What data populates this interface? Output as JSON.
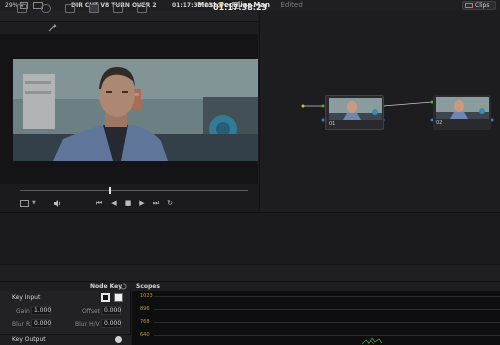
{
  "window": {
    "project_title": "Most Peculiar Man",
    "status": "Edited",
    "clips_label": "Clips"
  },
  "viewer": {
    "zoom": "29%",
    "clip_name": "DIR CUT V8 TURN OVER 2",
    "header_timecode": "01:17:38:23",
    "transport_timecode": "01:17:38:23",
    "playhead_fraction": 0.39
  },
  "nodes": [
    {
      "label": "01"
    },
    {
      "label": "02"
    }
  ],
  "node_key": {
    "title": "Node Key",
    "key_input_label": "Key Input",
    "gain_label": "Gain",
    "gain_value": "1.000",
    "offset_label": "Offset",
    "offset_value": "0.000",
    "blur_r_label": "Blur R.",
    "blur_r_value": "0.000",
    "blur_hv_label": "Blur H/V",
    "blur_hv_value": "0.000",
    "key_output_label": "Key Output"
  },
  "scopes": {
    "title": "Scopes",
    "ticks": [
      "1023",
      "896",
      "768",
      "640"
    ]
  },
  "colors": {
    "accent_red": "#d96a6a",
    "node_selected_border": "#7a2a2a",
    "scope_label": "#b89a3a"
  }
}
